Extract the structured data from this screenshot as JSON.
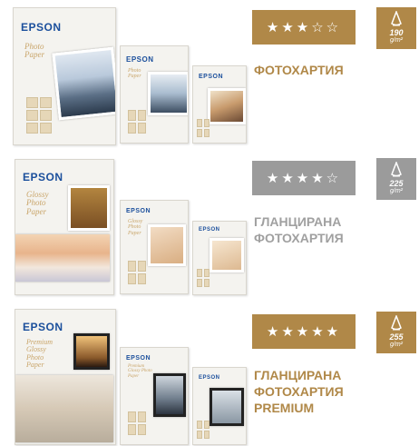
{
  "colors": {
    "gold": "#b08848",
    "silver": "#9b9b9b",
    "title_gold": "#b08848",
    "title_silver": "#a0a0a0"
  },
  "products": [
    {
      "logo": "EPSON",
      "pack_name": "Photo Paper",
      "rating_stars": "★★★☆☆",
      "rating": 3,
      "weight": "190",
      "weight_unit": "g/m²",
      "title_lines": [
        "ФОТОХАРТИЯ"
      ]
    },
    {
      "logo": "EPSON",
      "pack_name": "Glossy Photo Paper",
      "rating_stars": "★★★★☆",
      "rating": 4,
      "weight": "225",
      "weight_unit": "g/m²",
      "title_lines": [
        "ГЛАНЦИРАНА",
        "ФОТОХАРТИЯ"
      ]
    },
    {
      "logo": "EPSON",
      "pack_name": "Premium Glossy Photo Paper",
      "rating_stars": "★★★★★",
      "rating": 5,
      "weight": "255",
      "weight_unit": "g/m²",
      "title_lines": [
        "ГЛАНЦИРАНА",
        "ФОТОХАРТИЯ",
        "PREMIUM"
      ]
    }
  ]
}
